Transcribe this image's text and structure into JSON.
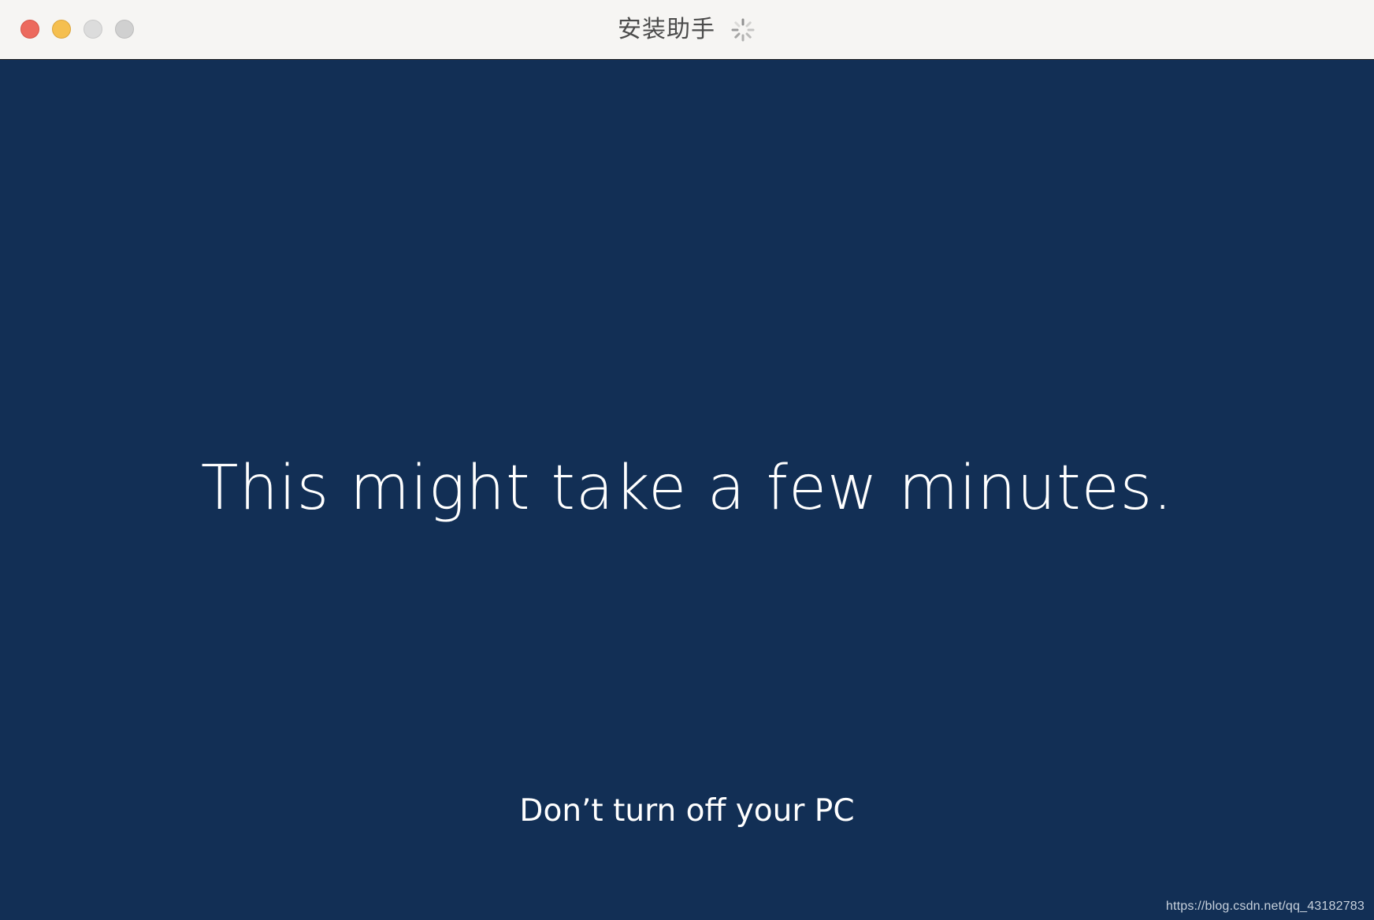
{
  "window": {
    "title": "安装助手",
    "controls": [
      "close",
      "minimize",
      "zoom",
      "extra"
    ]
  },
  "main": {
    "headline": "This might take a few minutes.",
    "subtext": "Don’t turn off your PC"
  },
  "watermark": "https://blog.csdn.net/qq_43182783",
  "colors": {
    "titlebar": "#f6f5f3",
    "background": "#122f55",
    "text": "#ffffff",
    "close": "#ec6a5e",
    "minimize": "#f5bf4f",
    "inactive": "#d0d0d0"
  },
  "icons": {
    "loading": "spinner-icon"
  }
}
